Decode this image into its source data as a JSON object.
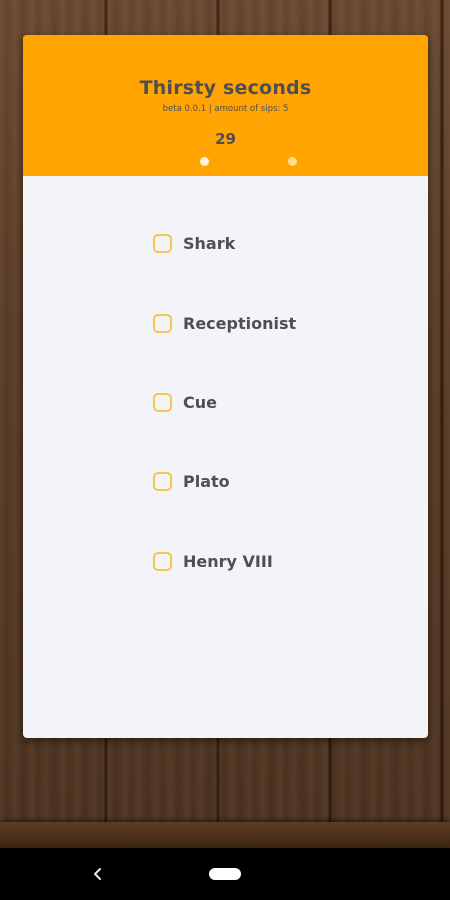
{
  "app": {
    "title": "Thirsty seconds",
    "subtitle": "beta 0.0.1 | amount of sips: 5",
    "timer": "29"
  },
  "options": [
    {
      "label": "Shark",
      "checked": false
    },
    {
      "label": "Receptionist",
      "checked": false
    },
    {
      "label": "Cue",
      "checked": false
    },
    {
      "label": "Plato",
      "checked": false
    },
    {
      "label": "Henry VIII",
      "checked": false
    }
  ],
  "nav": {
    "back_icon": "back-chevron-icon",
    "home_icon": "home-pill-icon"
  },
  "colors": {
    "header": "#ffa400",
    "card": "#f2f4f7",
    "text": "#4f4f52",
    "checkbox_border": "#f5c451"
  }
}
